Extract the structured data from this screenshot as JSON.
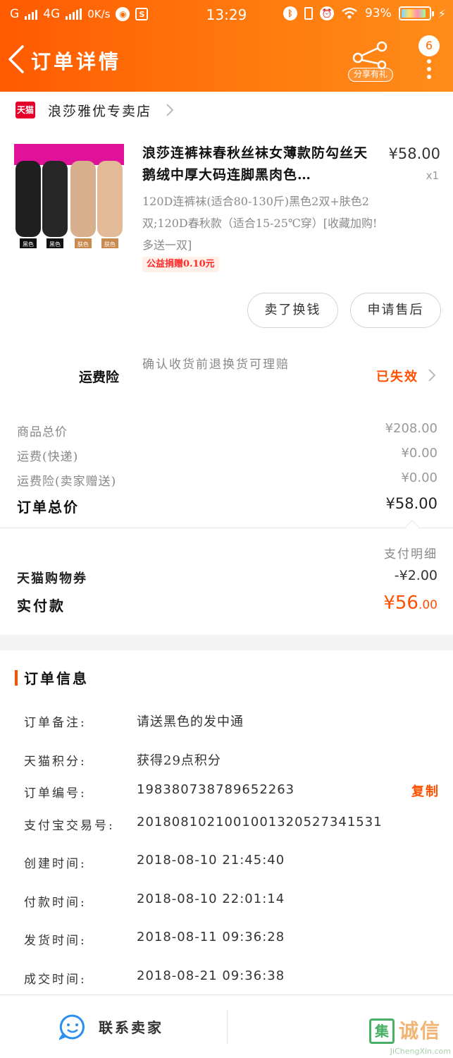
{
  "status_bar": {
    "network1": "G",
    "network2": "4G",
    "speed": "0K/s",
    "icon_s": "S",
    "time": "13:29",
    "battery": "93%"
  },
  "nav": {
    "title": "订单详情",
    "share_label": "分享有礼",
    "badge_count": "6"
  },
  "shop": {
    "platform_badge": "天猫",
    "name": "浪莎雅优专卖店"
  },
  "product": {
    "title": "浪莎连裤袜春秋丝袜女薄款防勾丝天鹅绒中厚大码连脚黑肉色…",
    "price": "¥58.00",
    "qty": "x1",
    "sku": "120D连裤袜(适合80-130斤)黑色2双+肤色2双;120D春秋款（适合15-25℃穿）[收藏加购!多送一双]",
    "charity": "公益捐赠0.10元",
    "thumb_labels": [
      "黑色",
      "黑色",
      "肤色",
      "肤色"
    ]
  },
  "actions": {
    "sell_label": "卖了换钱",
    "after_sale_label": "申请售后"
  },
  "insurance": {
    "label": "运费险",
    "desc": "确认收货前退换货可理赔",
    "status": "已失效"
  },
  "price_summary": {
    "goods_total_label": "商品总价",
    "goods_total": "¥208.00",
    "shipping_label": "运费(快递)",
    "shipping": "¥0.00",
    "insurance_label": "运费险(卖家赠送)",
    "insurance": "¥0.00",
    "order_total_label": "订单总价",
    "order_total": "¥58.00",
    "pay_detail": "支付明细",
    "coupon_label": "天猫购物券",
    "coupon": "-¥2.00",
    "paid_label": "实付款",
    "paid_main": "¥56",
    "paid_cents": ".00"
  },
  "order_info": {
    "title": "订单信息",
    "copy": "复制",
    "rows": [
      {
        "label": "订单备注:",
        "value": "请送黑色的发中通"
      },
      {
        "label": "天猫积分:",
        "value": "获得29点积分"
      },
      {
        "label": "订单编号:",
        "value": "198380738789652263"
      },
      {
        "label": "支付宝交易号:",
        "value": "2018081021001001320527341531"
      },
      {
        "label": "创建时间:",
        "value": "2018-08-10 21:45:40"
      },
      {
        "label": "付款时间:",
        "value": "2018-08-10 22:01:14"
      },
      {
        "label": "发货时间:",
        "value": "2018-08-11 09:36:28"
      },
      {
        "label": "成交时间:",
        "value": "2018-08-21 09:36:38"
      }
    ]
  },
  "bottom": {
    "contact_label": "联系卖家"
  },
  "watermark": {
    "box": "集",
    "text": "诚信",
    "url": "JiChengXin.com"
  },
  "colors": {
    "accent": "#ff5000",
    "header_start": "#ff5a00",
    "header_end": "#ff8c1a",
    "tmall_red": "#e4002b",
    "chat_blue": "#2b8ff0"
  }
}
